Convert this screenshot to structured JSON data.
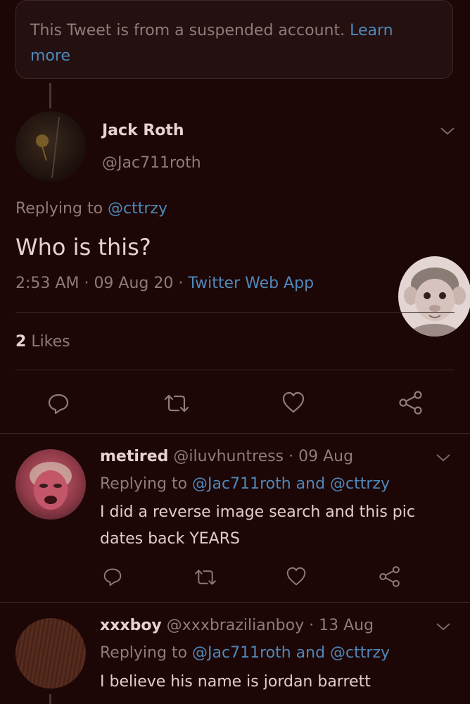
{
  "suspended": {
    "text": "This Tweet is from a suspended account.",
    "link": "Learn more"
  },
  "main_tweet": {
    "name": "Jack Roth",
    "handle": "@Jac711roth",
    "replying_prefix": "Replying to",
    "replying_to": "@cttrzy",
    "text": "Who is this?",
    "time": "2:53 AM",
    "date": "09 Aug 20",
    "source": "Twitter Web App",
    "likes_count": "2",
    "likes_label": "Likes"
  },
  "replies": [
    {
      "name": "metired",
      "handle": "@iluvhuntress",
      "date": "09 Aug",
      "replying_prefix": "Replying to",
      "replying_to": "@Jac711roth and @cttrzy",
      "text_line1": "I did a reverse image search and this pic",
      "text_line2": "dates back YEARS"
    },
    {
      "name": "xxxboy",
      "handle": "@xxxbrazilianboy",
      "date": "13 Aug",
      "replying_prefix": "Replying to",
      "replying_to": "@Jac711roth and @cttrzy",
      "text_line1": "I believe his name is jordan barrett"
    }
  ],
  "colors": {
    "background": "#1d0606",
    "text": "#d9c5c2",
    "muted": "#8f7b78",
    "link": "#4f88b9"
  },
  "icons": {
    "reply": "reply-icon",
    "retweet": "retweet-icon",
    "like": "heart-icon",
    "share": "share-icon",
    "more": "chevron-down-icon"
  }
}
